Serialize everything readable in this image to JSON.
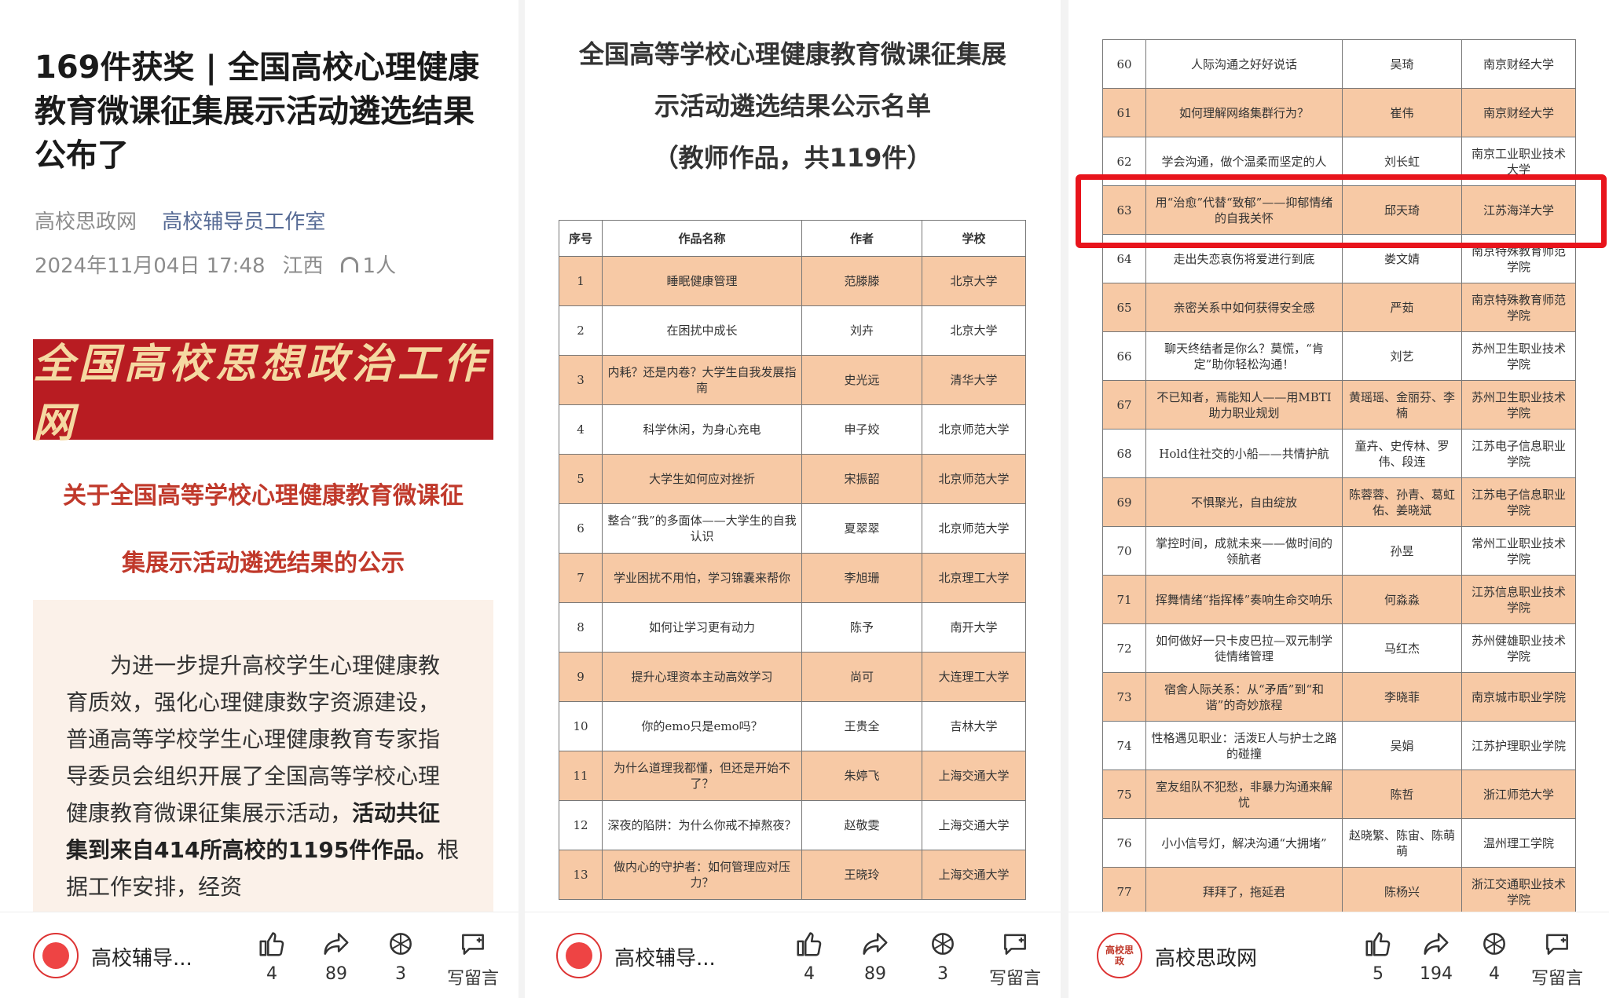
{
  "panel1": {
    "title": "169件获奖 | 全国高校心理健康教育微课征集展示活动遴选结果公布了",
    "source": "高校思政网",
    "account": "高校辅导员工作室",
    "date": "2024年11月04日 17:48",
    "location": "江西",
    "listeners": "1人",
    "banner": "全国高校思想政治工作网",
    "notice_title_line1": "关于全国高等学校心理健康教育微课征",
    "notice_title_line2": "集展示活动遴选结果的公示",
    "body_plain": "为进一步提升高校学生心理健康教育质效，强化心理健康数字资源建设，普通高等学校学生心理健康教育专家指导委员会组织开展了全国高等学校心理健康教育微课征集展示活动，",
    "body_bold": "活动共征集到来自414所高校的1195件作品。",
    "body_tail": "根据工作安排，经资",
    "bottom": {
      "account": "高校辅导...",
      "likes": "4",
      "shares": "89",
      "favorites": "3",
      "comment_label": "写留言"
    }
  },
  "panel2": {
    "title_line1": "全国高等学校心理健康教育微课征集展",
    "title_line2": "示活动遴选结果公示名单",
    "title_line3": "（教师作品，共119件）",
    "headers": [
      "序号",
      "作品名称",
      "作者",
      "学校"
    ],
    "rows": [
      [
        "1",
        "睡眠健康管理",
        "范滕滕",
        "北京大学"
      ],
      [
        "2",
        "在困扰中成长",
        "刘卉",
        "北京大学"
      ],
      [
        "3",
        "内耗？还是内卷？大学生自我发展指南",
        "史光远",
        "清华大学"
      ],
      [
        "4",
        "科学休闲，为身心充电",
        "申子姣",
        "北京师范大学"
      ],
      [
        "5",
        "大学生如何应对挫折",
        "宋振韶",
        "北京师范大学"
      ],
      [
        "6",
        "整合“我”的多面体——大学生的自我认识",
        "夏翠翠",
        "北京师范大学"
      ],
      [
        "7",
        "学业困扰不用怕，学习锦囊来帮你",
        "李旭珊",
        "北京理工大学"
      ],
      [
        "8",
        "如何让学习更有动力",
        "陈予",
        "南开大学"
      ],
      [
        "9",
        "提升心理资本主动高效学习",
        "尚可",
        "大连理工大学"
      ],
      [
        "10",
        "你的emo只是emo吗？",
        "王贵全",
        "吉林大学"
      ],
      [
        "11",
        "为什么道理我都懂，但还是开始不了？",
        "朱婷飞",
        "上海交通大学"
      ],
      [
        "12",
        "深夜的陷阱：为什么你戒不掉熬夜？",
        "赵敬雯",
        "上海交通大学"
      ],
      [
        "13",
        "做内心的守护者：如何管理应对压力？",
        "王晓玲",
        "上海交通大学"
      ]
    ],
    "bottom": {
      "account": "高校辅导...",
      "likes": "4",
      "shares": "89",
      "favorites": "3",
      "comment_label": "写留言"
    }
  },
  "panel3": {
    "rows": [
      [
        "60",
        "人际沟通之好好说话",
        "吴琦",
        "南京财经大学"
      ],
      [
        "61",
        "如何理解网络集群行为？",
        "崔伟",
        "南京财经大学"
      ],
      [
        "62",
        "学会沟通，做个温柔而坚定的人",
        "刘长虹",
        "南京工业职业技术大学"
      ],
      [
        "63",
        "用“治愈”代替“致郁”——抑郁情绪的自我关怀",
        "邱天琦",
        "江苏海洋大学"
      ],
      [
        "64",
        "走出失恋哀伤将爱进行到底",
        "娄文婧",
        "南京特殊教育师范学院"
      ],
      [
        "65",
        "亲密关系中如何获得安全感",
        "严茹",
        "南京特殊教育师范学院"
      ],
      [
        "66",
        "聊天终结者是你么？莫慌，“肯定”助你轻松沟通！",
        "刘艺",
        "苏州卫生职业技术学院"
      ],
      [
        "67",
        "不已知者，焉能知人——用MBTI助力职业规划",
        "黄瑶瑶、金丽芬、李楠",
        "苏州卫生职业技术学院"
      ],
      [
        "68",
        "Hold住社交的小船——共情护航",
        "童卉、史传林、罗伟、段连",
        "江苏电子信息职业学院"
      ],
      [
        "69",
        "不惧聚光，自由绽放",
        "陈蓉蓉、孙青、葛虹佑、姜晓斌",
        "江苏电子信息职业学院"
      ],
      [
        "70",
        "掌控时间，成就未来——做时间的领航者",
        "孙昱",
        "常州工业职业技术学院"
      ],
      [
        "71",
        "挥舞情绪“指挥棒”奏响生命交响乐",
        "何淼淼",
        "江苏信息职业技术学院"
      ],
      [
        "72",
        "如何做好一只卡皮巴拉—双元制学徒情绪管理",
        "马红杰",
        "苏州健雄职业技术学院"
      ],
      [
        "73",
        "宿舍人际关系：从“矛盾”到“和谐”的奇妙旅程",
        "李晓菲",
        "南京城市职业学院"
      ],
      [
        "74",
        "性格遇见职业：活泼E人与护士之路的碰撞",
        "吴娟",
        "江苏护理职业学院"
      ],
      [
        "75",
        "室友组队不犯愁，非暴力沟通来解忧",
        "陈哲",
        "浙江师范大学"
      ],
      [
        "76",
        "小小信号灯，解决沟通“大拥堵”",
        "赵晓繁、陈宙、陈萌萌",
        "温州理工学院"
      ],
      [
        "77",
        "拜拜了，拖延君",
        "陈杨兴",
        "浙江交通职业技术学院"
      ]
    ],
    "bottom": {
      "account": "高校思政网",
      "avatar_text": "高校思政",
      "likes": "5",
      "shares": "194",
      "favorites": "4",
      "comment_label": "写留言"
    }
  },
  "colors": {
    "accent_red": "#e8141c",
    "row_peach": "#f7c9a5",
    "banner_red": "#b81c22",
    "link_blue": "#576b95"
  },
  "icons": [
    "headphone-icon",
    "thumbs-up-icon",
    "share-icon",
    "favorite-icon",
    "comment-icon"
  ]
}
